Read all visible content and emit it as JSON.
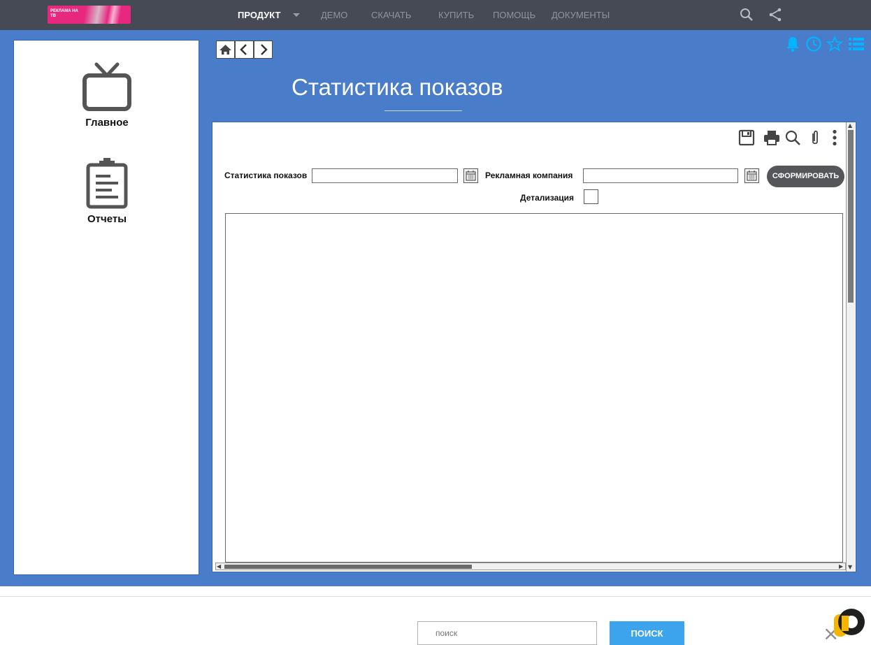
{
  "logo": {
    "text": "РЕКЛАМА НА ТВ"
  },
  "nav": {
    "items": [
      "ПРОДУКТ",
      "ДЕМО",
      "СКАЧАТЬ",
      "КУПИТЬ",
      "ПОМОЩЬ",
      "ДОКУМЕНТЫ"
    ],
    "active": "ПРОДУКТ"
  },
  "sidebar": {
    "items": [
      {
        "label": "Главное",
        "icon": "tv-icon"
      },
      {
        "label": "Отчеты",
        "icon": "clipboard-icon"
      }
    ]
  },
  "page": {
    "title": "Статистика показов"
  },
  "form": {
    "stats_label": "Статистика показов",
    "stats_value": "",
    "campaign_label": "Рекламная компания",
    "campaign_value": "",
    "detail_label": "Детализация",
    "generate_label": "СФОРМИРОВАТЬ"
  },
  "footer": {
    "search_placeholder": "поиск",
    "search_button": "ПОИСК"
  },
  "colors": {
    "topbar": "#464a55",
    "main_bg": "#4a7dc9",
    "accent_icons": "#00b4ff",
    "button_dark": "#555659",
    "search_button": "#3ba4ec"
  }
}
